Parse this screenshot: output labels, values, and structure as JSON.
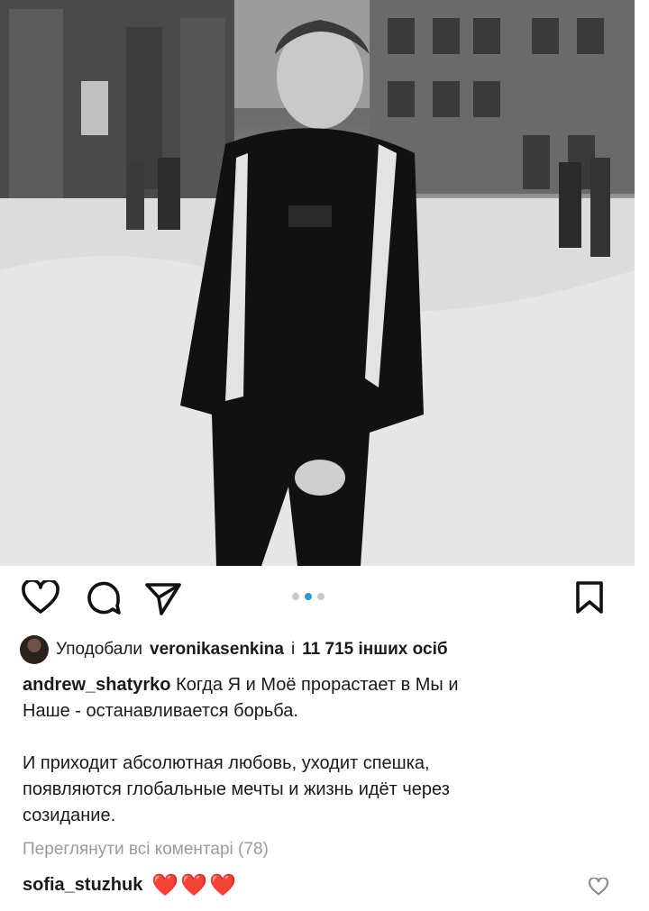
{
  "post": {
    "image_description_icon": "photo",
    "carousel": {
      "count": 3,
      "active": 2
    }
  },
  "actions": {
    "like_icon": "heart-outline-icon",
    "comment_icon": "speech-bubble-icon",
    "share_icon": "paper-plane-icon",
    "save_icon": "bookmark-icon"
  },
  "likes": {
    "prefix": "Уподобали",
    "user": "veronikasenkina",
    "joiner": "і",
    "others": "11 715 інших осіб"
  },
  "caption": {
    "author": "andrew_shatyrko",
    "line1": "Когда Я и Моё прорастает в Мы и",
    "line2": "Наше - останавливается борьба.",
    "line3": "И приходит абсолютная любовь, уходит спешка,",
    "line4": "появляются глобальные мечты и жизнь идёт через",
    "line5": "созидание."
  },
  "comments": {
    "view_all": "Переглянути всі коментарі (78)",
    "items": [
      {
        "user": "sofia_stuzhuk",
        "text": "❤️❤️❤️"
      }
    ]
  },
  "colors": {
    "accent_dot": "#2f9bd6",
    "heart_red": "#e0232e",
    "muted_text": "#9a9a9a"
  }
}
